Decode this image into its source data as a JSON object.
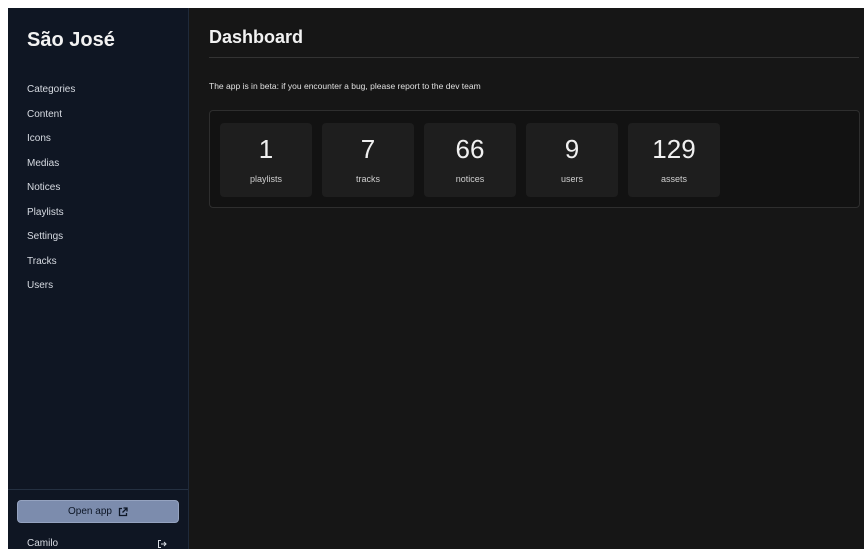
{
  "sidebar": {
    "title": "São José",
    "nav": [
      {
        "label": "Categories"
      },
      {
        "label": "Content"
      },
      {
        "label": "Icons"
      },
      {
        "label": "Medias"
      },
      {
        "label": "Notices"
      },
      {
        "label": "Playlists"
      },
      {
        "label": "Settings"
      },
      {
        "label": "Tracks"
      },
      {
        "label": "Users"
      }
    ],
    "open_app_label": "Open app",
    "open_app_icon": "external-link-icon",
    "user_name": "Camilo",
    "logout_icon": "logout-icon"
  },
  "main": {
    "title": "Dashboard",
    "beta_notice": "The app is in beta: if you encounter a bug, please report to the dev team",
    "stats": [
      {
        "value": "1",
        "label": "playlists"
      },
      {
        "value": "7",
        "label": "tracks"
      },
      {
        "value": "66",
        "label": "notices"
      },
      {
        "value": "9",
        "label": "users"
      },
      {
        "value": "129",
        "label": "assets"
      }
    ]
  },
  "colors": {
    "sidebar_bg": "#0f1623",
    "main_bg": "#161616",
    "button_bg": "#7c8cad",
    "card_bg": "#1e1e1e"
  }
}
